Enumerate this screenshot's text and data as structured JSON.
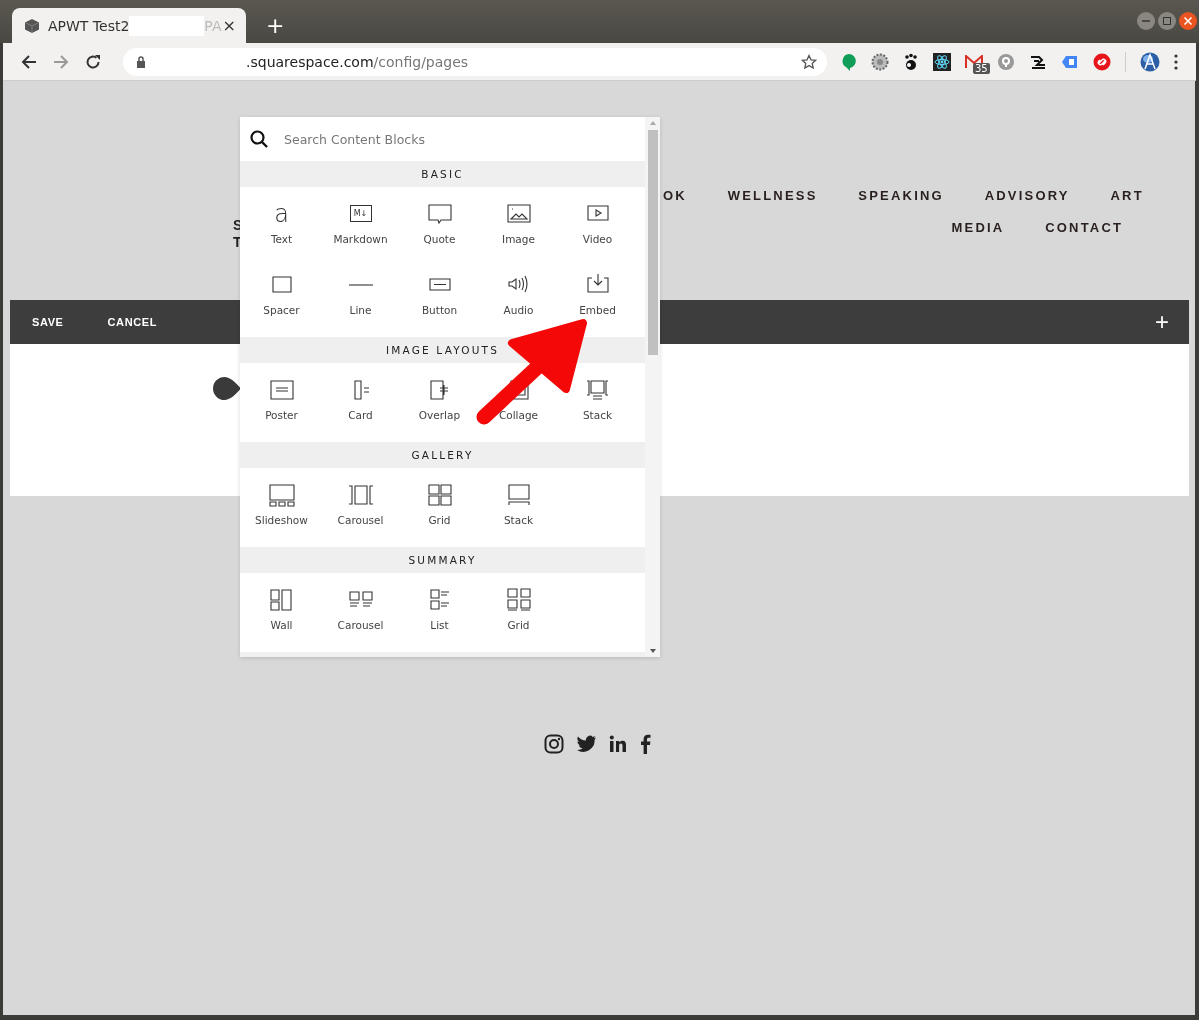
{
  "browser": {
    "tab": {
      "title": "APWT Test2",
      "title_tail": "PA",
      "close": "×"
    },
    "new_tab": "+",
    "url": {
      "host": ".squarespace.com",
      "path": "/config/pages"
    },
    "mail_badge": "35"
  },
  "site": {
    "title_fragments": [
      "S",
      "T"
    ],
    "nav_rows": [
      [
        "OK",
        "WELLNESS",
        "SPEAKING",
        "ADVISORY",
        "ART"
      ],
      [
        "MEDIA",
        "CONTACT"
      ]
    ]
  },
  "editor_bar": {
    "save": "SAVE",
    "cancel": "CANCEL",
    "add": "+"
  },
  "block_panel": {
    "search": {
      "placeholder": "Search Content Blocks"
    },
    "sections": [
      {
        "title": "BASIC",
        "items": [
          {
            "label": "Text",
            "kind": "text",
            "glyph": "a"
          },
          {
            "label": "Markdown",
            "kind": "markdown",
            "glyph": "M↓"
          },
          {
            "label": "Quote",
            "kind": "quote"
          },
          {
            "label": "Image",
            "kind": "image"
          },
          {
            "label": "Video",
            "kind": "video"
          },
          {
            "label": "Spacer",
            "kind": "spacer"
          },
          {
            "label": "Line",
            "kind": "line"
          },
          {
            "label": "Button",
            "kind": "button"
          },
          {
            "label": "Audio",
            "kind": "audio"
          },
          {
            "label": "Embed",
            "kind": "embed"
          }
        ]
      },
      {
        "title": "IMAGE LAYOUTS",
        "items": [
          {
            "label": "Poster",
            "kind": "poster"
          },
          {
            "label": "Card",
            "kind": "card"
          },
          {
            "label": "Overlap",
            "kind": "overlap"
          },
          {
            "label": "Collage",
            "kind": "collage"
          },
          {
            "label": "Stack",
            "kind": "stack-layout"
          }
        ]
      },
      {
        "title": "GALLERY",
        "items": [
          {
            "label": "Slideshow",
            "kind": "slideshow"
          },
          {
            "label": "Carousel",
            "kind": "carousel-gallery"
          },
          {
            "label": "Grid",
            "kind": "grid-gallery"
          },
          {
            "label": "Stack",
            "kind": "stack-gallery"
          }
        ]
      },
      {
        "title": "SUMMARY",
        "items": [
          {
            "label": "Wall",
            "kind": "wall"
          },
          {
            "label": "Carousel",
            "kind": "carousel-summary"
          },
          {
            "label": "List",
            "kind": "list"
          },
          {
            "label": "Grid",
            "kind": "grid-summary"
          }
        ]
      }
    ]
  }
}
